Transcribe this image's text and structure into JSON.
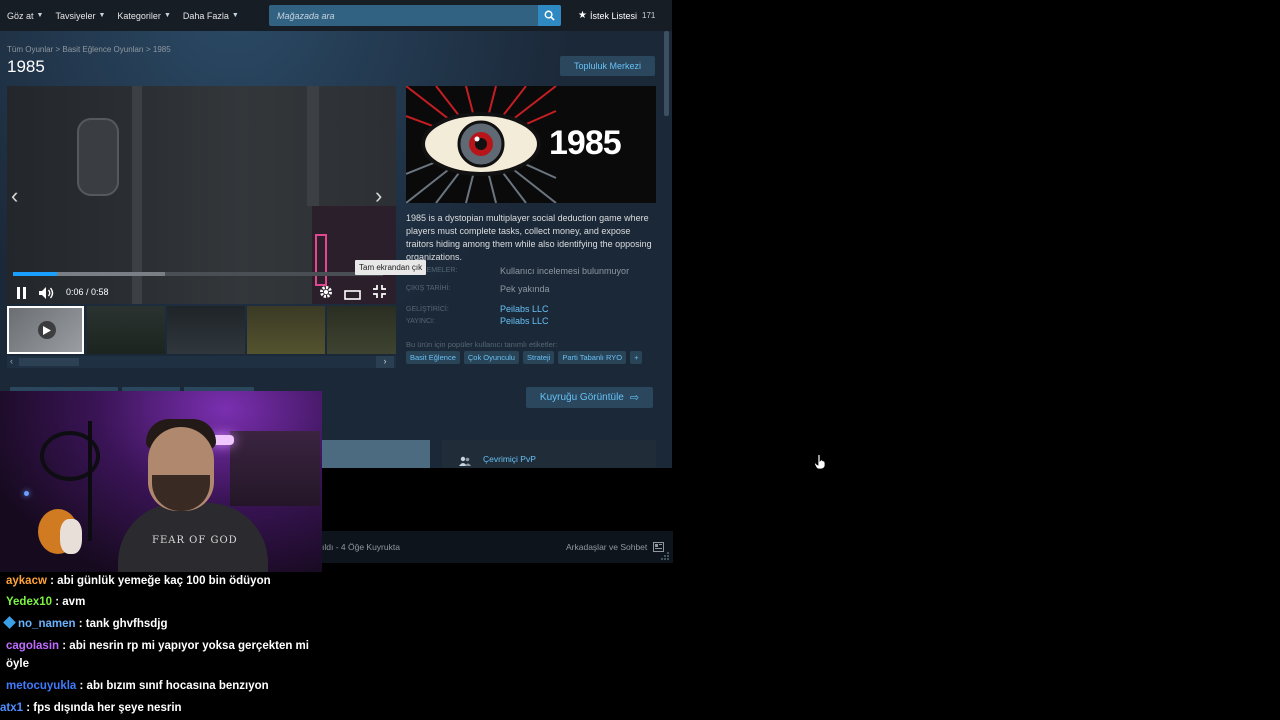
{
  "nav": {
    "items": [
      {
        "label": "Göz at"
      },
      {
        "label": "Tavsiyeler"
      },
      {
        "label": "Kategoriler"
      },
      {
        "label": "Daha Fazla"
      }
    ],
    "search_placeholder": "Mağazada ara",
    "wishlist_label": "İstek Listesi",
    "wishlist_count": "171"
  },
  "breadcrumb": {
    "items": [
      "Tüm Oyunlar",
      "Basit Eğlence Oyunları",
      "1985"
    ],
    "separator": ">"
  },
  "game": {
    "title": "1985",
    "community_button": "Topluluk Merkezi",
    "capsule_text": "1985",
    "description": "1985 is a dystopian multiplayer social deduction game where players must complete tasks, collect money, and expose traitors hiding among them while also identifying the opposing organizations.",
    "reviews_label": "İNCELEMELER:",
    "reviews_value": "Kullanıcı incelemesi bulunmuyor",
    "release_label": "ÇIKIŞ TARİHİ:",
    "release_value": "Pek yakında",
    "developer_label": "GELİŞTİRİCİ:",
    "developer_value": "Peilabs LLC",
    "publisher_label": "YAYINCI:",
    "publisher_value": "Peilabs LLC",
    "tags_label": "Bu ürün için popüler kullanıcı tanımlı etiketler:",
    "tags": [
      "Basit Eğlence",
      "Çok Oyunculu",
      "Strateji",
      "Parti Tabanlı RYO",
      "+"
    ]
  },
  "video": {
    "time": "0:06 / 0:58",
    "progress": 0.12,
    "tooltip": "Tam ekrandan çık"
  },
  "queue_button": "Kuyruğu Görüntüle",
  "feature_label": "Çevrimiçi PvP",
  "friends_bar": {
    "left_text": "ıldı - 4 Öğe Kuyrukta",
    "right_text": "Arkadaşlar ve Sohbet"
  },
  "webcam": {
    "shirt_text": "FEAR OF GOD"
  },
  "chat": [
    {
      "user": "aykacw",
      "color": "#ffa43a",
      "text": "abi günlük yemeğe kaç 100 bin ödüyon"
    },
    {
      "user": "Yedex10",
      "color": "#7cf542",
      "text": "avm"
    },
    {
      "user": "no_namen",
      "color": "#6ab4ff",
      "text": "tank ghvfhsdjg",
      "badge": true
    },
    {
      "user": "cagolasin",
      "color": "#c16bff",
      "text": "abi nesrin rp mi yapıyor yoksa gerçekten mi öyle"
    },
    {
      "user": "metocuyukla",
      "color": "#3f7bff",
      "text": "abı bızım sınıf hocasına benzıyon"
    },
    {
      "user": "atx1",
      "color": "#4f8fff",
      "text": "fps dışında her şeye nesrin"
    }
  ],
  "colors": {
    "steam_bg": "#1b2838",
    "accent": "#67c1f5",
    "progress": "#1a9fff"
  }
}
